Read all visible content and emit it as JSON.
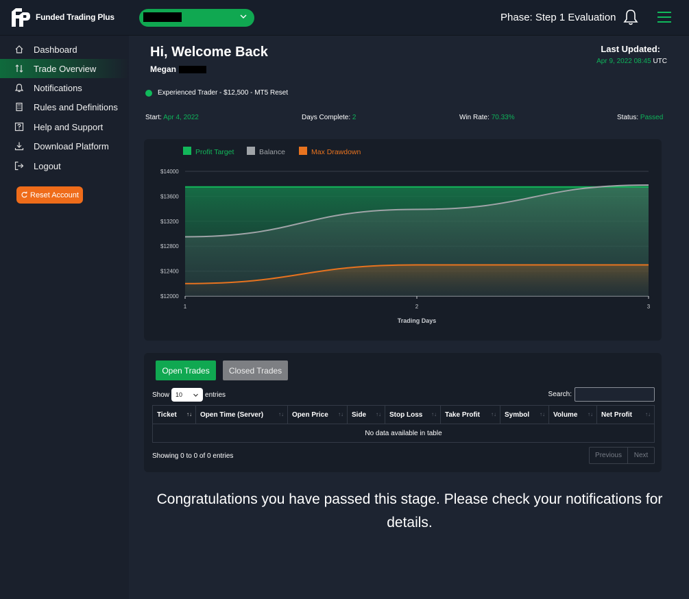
{
  "app": {
    "name": "Funded Trading Plus",
    "phase": "Phase: Step 1 Evaluation"
  },
  "sidebar": {
    "items": [
      {
        "label": "Dashboard",
        "icon": "home-icon"
      },
      {
        "label": "Trade Overview",
        "icon": "sort-arrows-icon",
        "active": true
      },
      {
        "label": "Notifications",
        "icon": "bell-icon"
      },
      {
        "label": "Rules and Definitions",
        "icon": "calculator-icon"
      },
      {
        "label": "Help and Support",
        "icon": "question-icon"
      },
      {
        "label": "Download Platform",
        "icon": "download-icon"
      },
      {
        "label": "Logout",
        "icon": "logout-icon"
      }
    ],
    "reset_label": "Reset Account"
  },
  "header": {
    "welcome": "Hi, Welcome Back",
    "user": "Megan",
    "last_updated_label": "Last Updated:",
    "last_updated_date": "Apr 9, 2022 08:45",
    "last_updated_tz": "UTC"
  },
  "account": {
    "description": "Experienced Trader - $12,500 - MT5 Reset"
  },
  "stats": {
    "start_label": "Start:",
    "start_value": "Apr 4, 2022",
    "days_label": "Days Complete:",
    "days_value": "2",
    "winrate_label": "Win Rate:",
    "winrate_value": "70.33%",
    "status_label": "Status:",
    "status_value": "Passed"
  },
  "chart_data": {
    "type": "area",
    "x": [
      1,
      2,
      3
    ],
    "xlabel": "Trading Days",
    "ylim": [
      12000,
      14000
    ],
    "yticks": [
      12000,
      12400,
      12800,
      13200,
      13600,
      14000
    ],
    "ytick_labels": [
      "$12000",
      "$12400",
      "$12800",
      "$13200",
      "$13600",
      "$14000"
    ],
    "series": [
      {
        "name": "Profit Target",
        "values": [
          13750,
          13750,
          13750
        ],
        "color": "#12b75a"
      },
      {
        "name": "Balance",
        "values": [
          12950,
          13390,
          13780
        ],
        "color": "#a0a4a8"
      },
      {
        "name": "Max Drawdown",
        "values": [
          12200,
          12500,
          12500
        ],
        "color": "#e8731f"
      }
    ],
    "legend": "top-left",
    "grid": true
  },
  "trades": {
    "tab_open": "Open Trades",
    "tab_closed": "Closed Trades",
    "show_label": "Show",
    "entries_value": "10",
    "entries_label": "entries",
    "search_label": "Search:",
    "columns": [
      "Ticket",
      "Open Time (Server)",
      "Open Price",
      "Side",
      "Stop Loss",
      "Take Profit",
      "Symbol",
      "Volume",
      "Net Profit"
    ],
    "empty_message": "No data available in table",
    "showing": "Showing 0 to 0 of 0 entries",
    "prev": "Previous",
    "next": "Next"
  },
  "message": "Congratulations you have passed this stage. Please check your notifications for details."
}
